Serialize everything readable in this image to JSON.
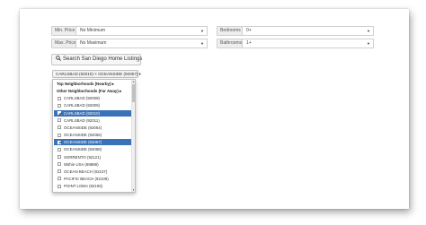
{
  "filters": {
    "min_price": {
      "label": "Min. Price",
      "value": "No Minimum"
    },
    "max_price": {
      "label": "Max. Price",
      "value": "No Maximum"
    },
    "bedrooms": {
      "label": "Bedrooms",
      "value": "0+"
    },
    "bathrooms": {
      "label": "Bathrooms",
      "value": "1+"
    }
  },
  "search_button": {
    "label": "Search San Diego Home Listings",
    "icon": "search-icon"
  },
  "neighborhood_select": {
    "button_label": "CARLSBAD (92010) × OCEANSIDE (92057) ▾",
    "options": [
      {
        "label": "Top Neighborhoods (Nearby) ▸",
        "type": "group",
        "checked": false
      },
      {
        "label": "Other Neighborhoods (Far Away) ▸",
        "type": "group",
        "checked": false
      },
      {
        "label": "CARLSBAD (92008)",
        "type": "item",
        "checked": false
      },
      {
        "label": "CARLSBAD (92009)",
        "type": "item",
        "checked": false
      },
      {
        "label": "CARLSBAD (92010)",
        "type": "item",
        "checked": true
      },
      {
        "label": "CARLSBAD (92011)",
        "type": "item",
        "checked": false
      },
      {
        "label": "OCEANSIDE (92054)",
        "type": "item",
        "checked": false
      },
      {
        "label": "OCEANSIDE (92056)",
        "type": "item",
        "checked": false
      },
      {
        "label": "OCEANSIDE (92057)",
        "type": "item",
        "checked": true
      },
      {
        "label": "OCEANSIDE (92058)",
        "type": "item",
        "checked": false
      },
      {
        "label": "SORRENTO (92121)",
        "type": "item",
        "checked": false
      },
      {
        "label": "Within USA (88888)",
        "type": "item",
        "checked": false
      },
      {
        "label": "OCEAN BEACH (92107)",
        "type": "item",
        "checked": false
      },
      {
        "label": "PACIFIC BEACH (92109)",
        "type": "item",
        "checked": false
      },
      {
        "label": "POINT LOMA (92106)",
        "type": "item",
        "checked": false
      }
    ]
  },
  "colors": {
    "selected_bg": "#3a72b8",
    "addon_bg": "#eeeeee",
    "border": "#cfcfcf"
  }
}
